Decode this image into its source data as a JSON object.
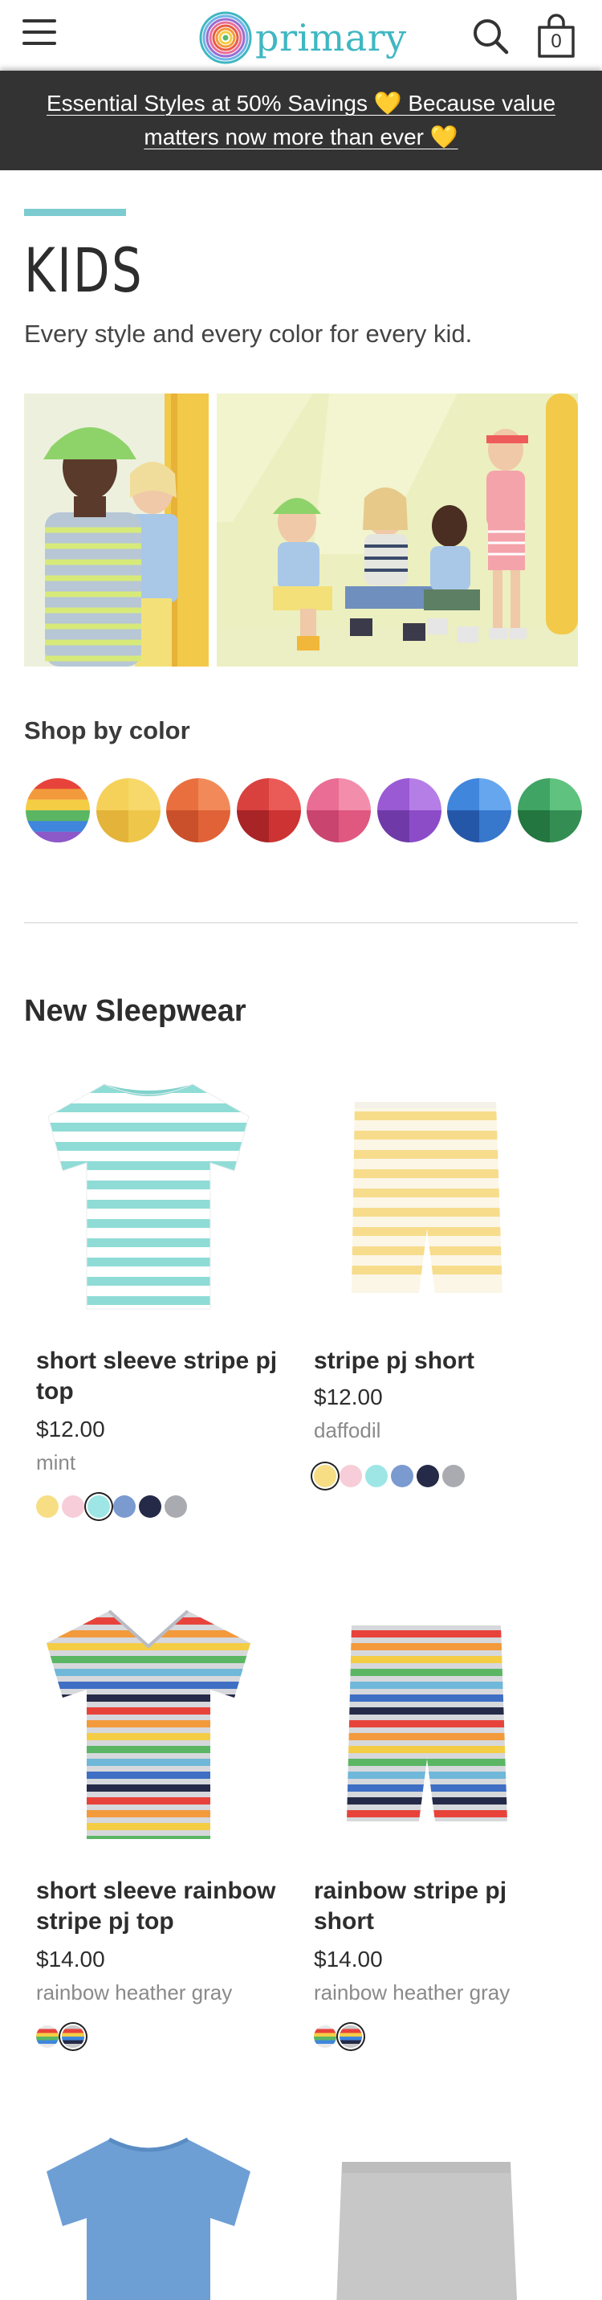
{
  "header": {
    "logo_text": "primary",
    "bag_count": "0",
    "menu_icon": "hamburger-menu-icon",
    "search_icon": "search-icon",
    "bag_icon": "shopping-bag-icon"
  },
  "promo": {
    "line1": "Essential Styles at 50% Savings 💛  Because value",
    "line2": "matters now more than ever 💛"
  },
  "page": {
    "title": "KIDS",
    "subtitle": "Every style and every color for every kid."
  },
  "shop_by_color": {
    "label": "Shop by color",
    "swatches": [
      {
        "name": "rainbow"
      },
      {
        "name": "yellow",
        "colors": [
          "#f6d15a",
          "#f7d86a",
          "#e3b33a",
          "#eec64a"
        ]
      },
      {
        "name": "orange",
        "colors": [
          "#e9703e",
          "#f18a58",
          "#c9502a",
          "#e16237"
        ]
      },
      {
        "name": "red",
        "colors": [
          "#d9413f",
          "#ea5a56",
          "#a82427",
          "#cc3332"
        ]
      },
      {
        "name": "pink",
        "colors": [
          "#ea6d96",
          "#f28dab",
          "#c9446f",
          "#e0577f"
        ]
      },
      {
        "name": "purple",
        "colors": [
          "#9a5ad4",
          "#b57ee6",
          "#6f3aa8",
          "#8c4cc8"
        ]
      },
      {
        "name": "blue",
        "colors": [
          "#3f86dc",
          "#66a6ee",
          "#2557a8",
          "#3777cc"
        ]
      },
      {
        "name": "green",
        "colors": [
          "#3fa464",
          "#5fc27e",
          "#23763f",
          "#348e54"
        ]
      }
    ]
  },
  "section_title": "New Sleepwear",
  "products": [
    {
      "name": "short sleeve stripe pj top",
      "price": "$12.00",
      "color": "mint",
      "swatches": [
        "#f7de84",
        "#f6cdd8",
        "#9ee6e6",
        "#7a9ad0",
        "#252a48",
        "#a9abb0"
      ],
      "selected": 2
    },
    {
      "name": "stripe pj short",
      "price": "$12.00",
      "color": "daffodil",
      "swatches": [
        "#f7de84",
        "#f6cdd8",
        "#9ee6e6",
        "#7a9ad0",
        "#252a48",
        "#a9abb0"
      ],
      "selected": 0
    },
    {
      "name": "short sleeve rainbow stripe pj top",
      "price": "$14.00",
      "color": "rainbow heather gray",
      "swatches": [
        "rainbow-light",
        "rainbow-dark"
      ],
      "selected": 1
    },
    {
      "name": "rainbow stripe pj short",
      "price": "$14.00",
      "color": "rainbow heather gray",
      "swatches": [
        "rainbow-light",
        "rainbow-dark"
      ],
      "selected": 1
    }
  ]
}
